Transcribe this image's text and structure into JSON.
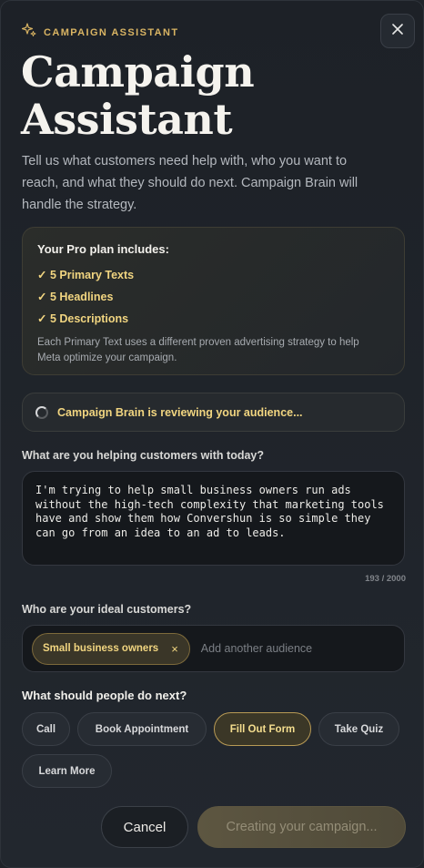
{
  "header": {
    "eyebrow": "CAMPAIGN ASSISTANT",
    "title": "Campaign Assistant",
    "subtitle": "Tell us what customers need help with, who you want to reach, and what they should do next. Campaign Brain will handle the strategy.",
    "close_icon": "close-icon",
    "eyebrow_icon": "sparkle-icon"
  },
  "plan": {
    "title": "Your Pro plan includes:",
    "items": [
      "✓ 5 Primary Texts",
      "✓ 5 Headlines",
      "✓ 5 Descriptions"
    ],
    "note": "Each Primary Text uses a different proven advertising strategy to help Meta optimize your campaign."
  },
  "status": {
    "text": "Campaign Brain is reviewing your audience..."
  },
  "help": {
    "label": "What are you helping customers with today?",
    "value": "I'm trying to help small business owners run ads\nwithout the high-tech complexity that marketing tools\nhave and show them how Convershun is so simple they\ncan go from an idea to an ad to leads.",
    "counter": "193 / 2000"
  },
  "audience": {
    "label": "Who are your ideal customers?",
    "chips": [
      "Small business owners"
    ],
    "remove_symbol": "×",
    "placeholder": "Add another audience"
  },
  "cta": {
    "label": "What should people do next?",
    "options": [
      "Call",
      "Book Appointment",
      "Fill Out Form",
      "Take Quiz",
      "Learn More"
    ],
    "selected": "Fill Out Form"
  },
  "footer": {
    "cancel_label": "Cancel",
    "submit_label": "Creating your campaign..."
  },
  "colors": {
    "accent": "#f1d580",
    "background": "#1f2329"
  }
}
